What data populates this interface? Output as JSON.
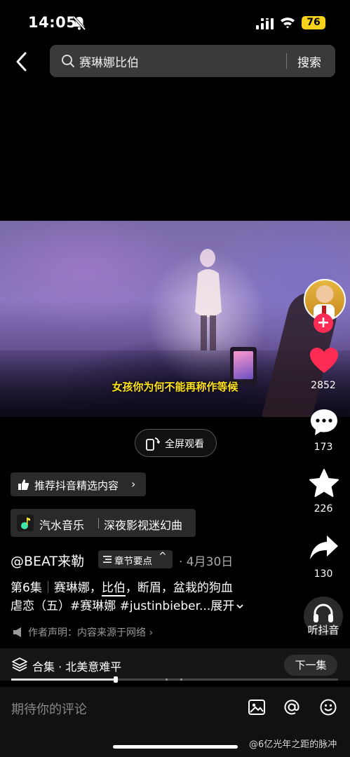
{
  "status_bar": {
    "time": "14:05",
    "battery": "76"
  },
  "search": {
    "query": "赛琳娜比伯",
    "button": "搜索"
  },
  "video": {
    "subtitle": "女孩你为何不能再称作等候"
  },
  "side_actions": {
    "likes": "2852",
    "comments": "173",
    "favorites": "226",
    "shares": "130",
    "listen_label": "听抖音"
  },
  "fullscreen": {
    "label": "全屏观看"
  },
  "recommend": {
    "label": "推荐抖音精选内容",
    "arrow": "›"
  },
  "music": {
    "app": "汽水音乐",
    "track": "深夜影视迷幻曲"
  },
  "author": {
    "handle": "@BEAT来勒",
    "chapter_label": "章节要点",
    "chapter_arrow": "^",
    "date": "· 4月30日"
  },
  "description": {
    "episode": "第6集",
    "sep": "｜",
    "part1": "赛琳娜，",
    "highlight": "比伯",
    "part2": "，断眉，盆栽的狗血",
    "line2": "虐恋（五）#赛琳娜 #justinbieber...",
    "expand": "展开"
  },
  "declaration": {
    "text": "作者声明：内容来源于网络 ›"
  },
  "collection": {
    "label": "合集 · 北美意难平",
    "next": "下一集"
  },
  "progress": {
    "fraction": 0.32
  },
  "comment_bar": {
    "placeholder": "期待你的评论"
  },
  "watermark": {
    "text": "@6亿光年之距的脉冲"
  }
}
